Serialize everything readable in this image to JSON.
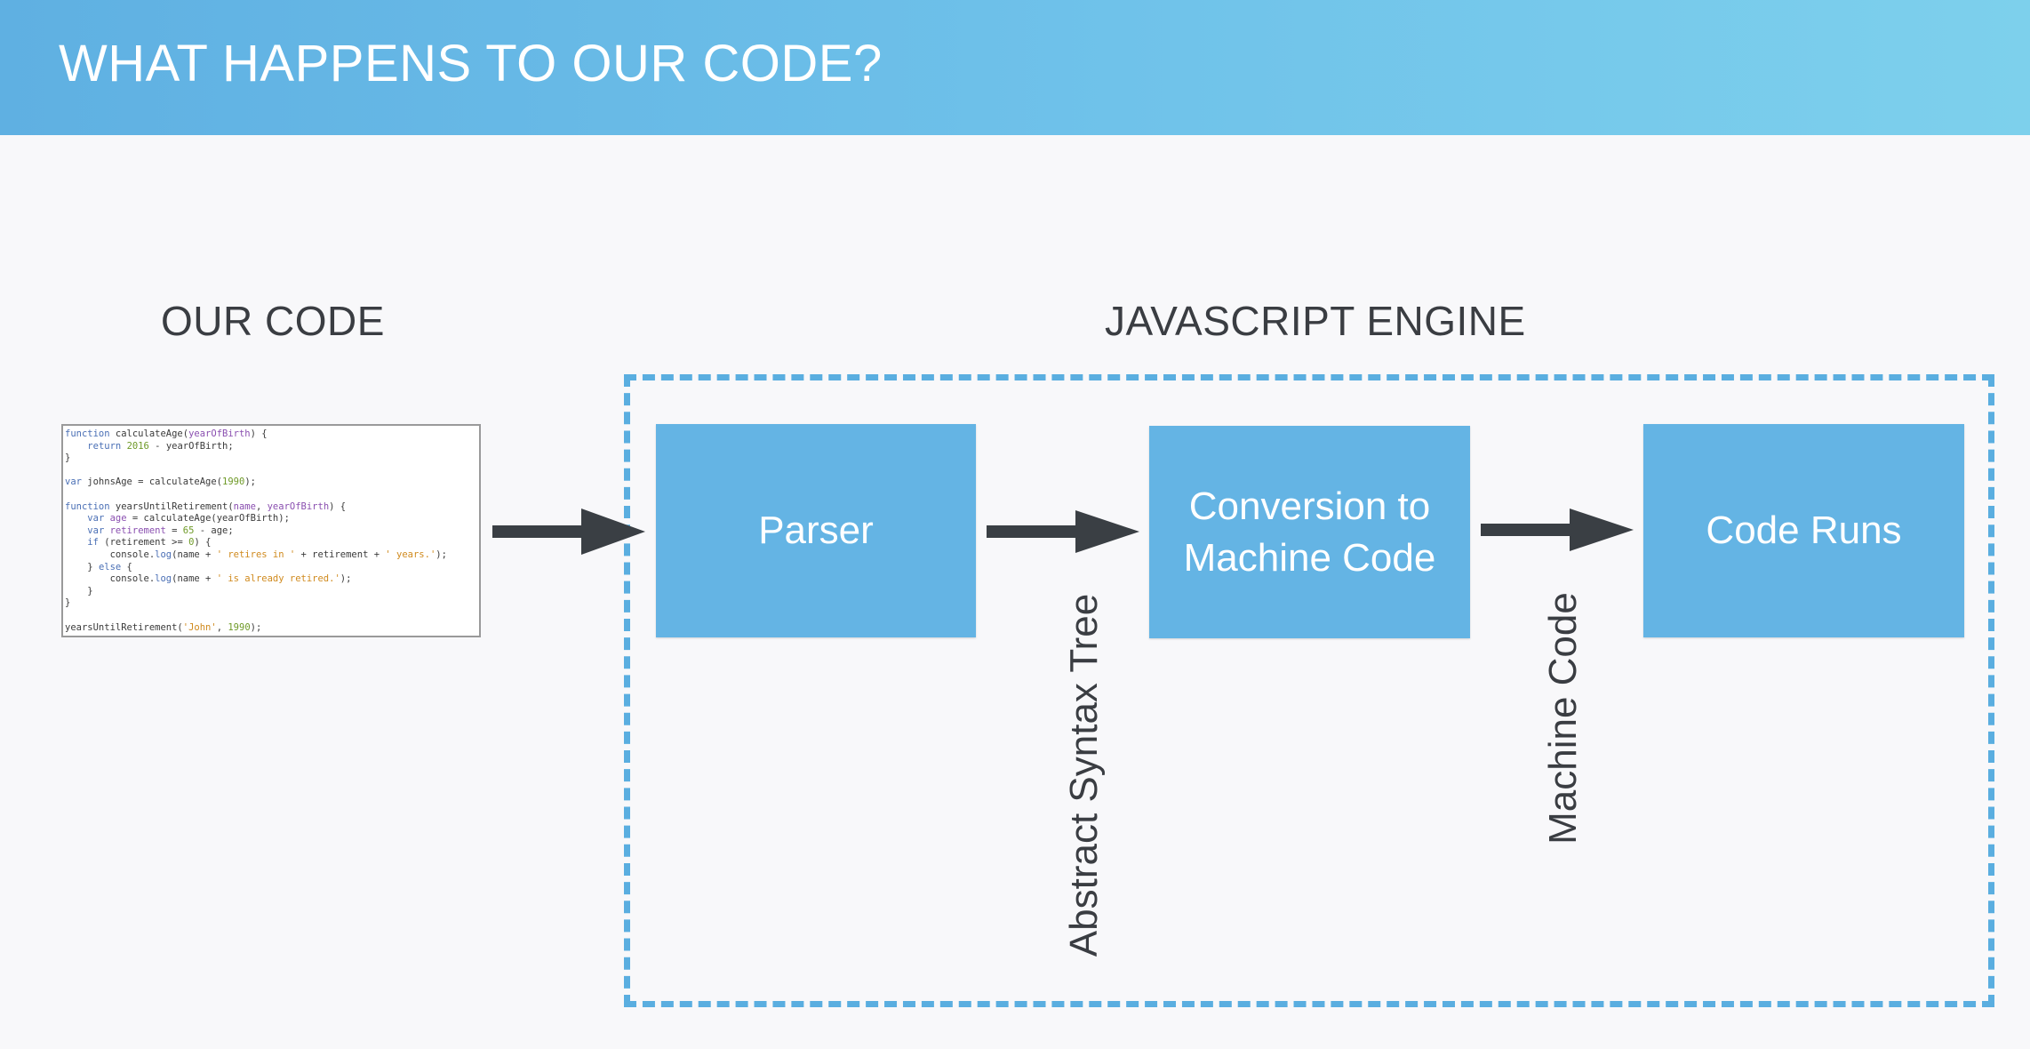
{
  "header": {
    "title": "WHAT HAPPENS TO OUR CODE?"
  },
  "our_code": {
    "label": "OUR CODE",
    "code_lines": [
      "function calculateAge(yearOfBirth) {",
      "    return 2016 - yearOfBirth;",
      "}",
      "",
      "var johnsAge = calculateAge(1990);",
      "",
      "function yearsUntilRetirement(name, yearOfBirth) {",
      "    var age = calculateAge(yearOfBirth);",
      "    var retirement = 65 - age;",
      "    if (retirement >= 0) {",
      "        console.log(name + ' retires in ' + retirement + ' years.');",
      "    } else {",
      "        console.log(name + ' is already retired.');",
      "    }",
      "}",
      "",
      "yearsUntilRetirement('John', 1990);"
    ]
  },
  "engine": {
    "label": "JAVASCRIPT ENGINE",
    "steps": [
      {
        "label": "Parser"
      },
      {
        "label": "Conversion to Machine Code"
      },
      {
        "label": "Code Runs"
      }
    ],
    "edge_labels": [
      "Abstract Syntax Tree",
      "Machine Code"
    ]
  },
  "colors": {
    "header": "#6fc2ea",
    "step_fill": "#64b4e4",
    "dashed_border": "#5aaee0",
    "arrow": "#3a3f44",
    "text_dark": "#3a3d42"
  }
}
